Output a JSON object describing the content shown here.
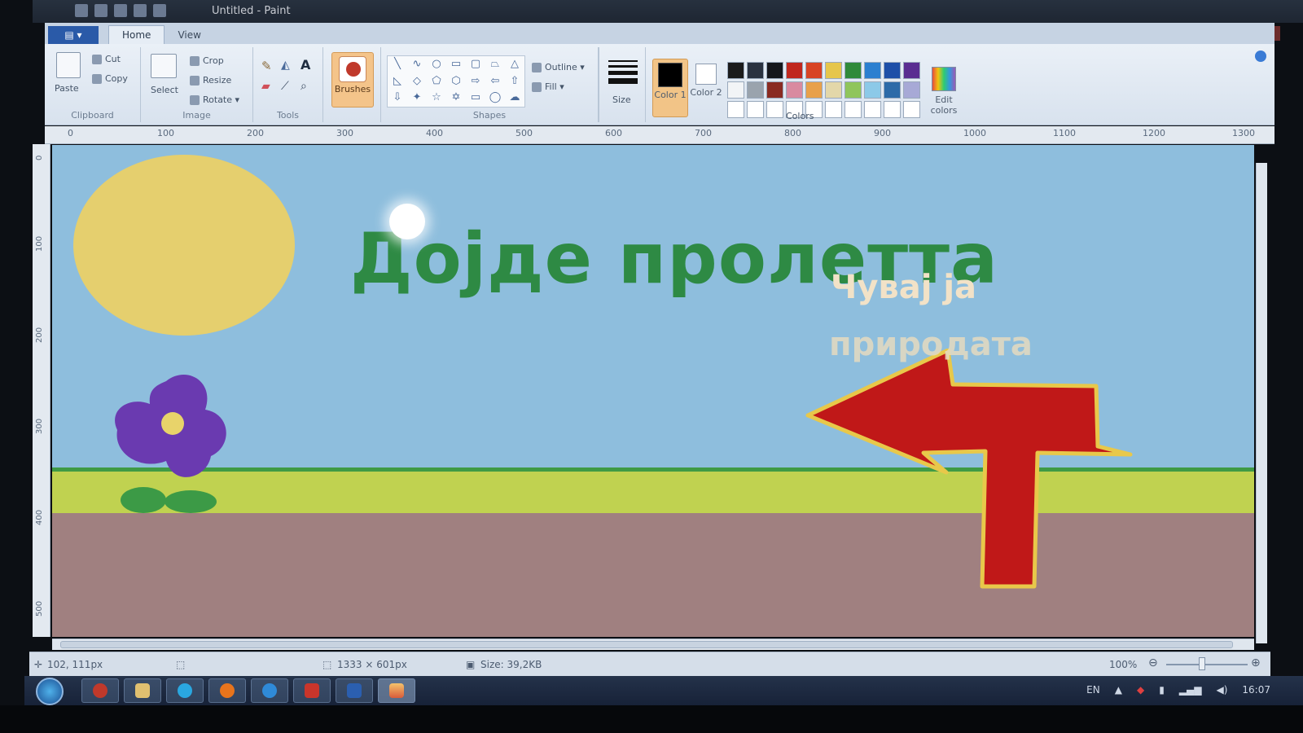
{
  "window": {
    "title": "Untitled - Paint"
  },
  "tabs": [
    {
      "label": "Home"
    },
    {
      "label": "View"
    }
  ],
  "ribbon": {
    "clipboard": {
      "paste": "Paste",
      "cut": "Cut",
      "copy": "Copy",
      "label": "Clipboard"
    },
    "image": {
      "select": "Select",
      "crop": "Crop",
      "resize": "Resize",
      "rotate": "Rotate",
      "label": "Image"
    },
    "tools": {
      "label": "Tools",
      "text_tool": "A"
    },
    "brushes": "Brushes",
    "shapes": {
      "label": "Shapes",
      "outline": "Outline",
      "fill": "Fill"
    },
    "size": "Size",
    "color1": "Color 1",
    "color2": "Color 2",
    "colors_label": "Colors",
    "edit_colors": "Edit colors",
    "palette": [
      "#1b1b1b",
      "#2a3240",
      "#15171c",
      "#c0271e",
      "#d84324",
      "#e6c64b",
      "#2f8a3a",
      "#2b7fd0",
      "#1d4fa8",
      "#5a2d91",
      "#f2f4f6",
      "#9aa3ad",
      "#8a2b22",
      "#d98aa0",
      "#e8a04a",
      "#e3d7a9",
      "#8fc55b",
      "#8cc9e8",
      "#2d6aa8",
      "#a7a9d6",
      "#ffffff",
      "#ffffff",
      "#ffffff",
      "#ffffff",
      "#ffffff",
      "#ffffff",
      "#ffffff",
      "#ffffff",
      "#ffffff",
      "#ffffff"
    ]
  },
  "ruler": {
    "marks": [
      "0",
      "100",
      "200",
      "300",
      "400",
      "500",
      "600",
      "700",
      "800",
      "900",
      "1000",
      "1100",
      "1200",
      "1300"
    ]
  },
  "ruler_left": {
    "marks": [
      "0",
      "100",
      "200",
      "300",
      "400",
      "500"
    ]
  },
  "canvas": {
    "headline": "Дојде пролетта",
    "sign_line1": "Чувај ја",
    "sign_line2": "природата"
  },
  "status": {
    "cursor": "102, 111px",
    "dimensions": "1333 × 601px",
    "size": "Size: 39,2KB",
    "zoom": "100%"
  },
  "taskbar": {
    "language": "EN",
    "clock": "16:07"
  },
  "colors": {
    "sky": "#8ebedd",
    "sun": "#e5cf6e",
    "headline": "#2e8a44",
    "grass": "#c0d250",
    "ground": "#a08080",
    "arrow": "#c01818",
    "arrow_outline": "#e8c84a",
    "flower": "#6a3ab0"
  }
}
